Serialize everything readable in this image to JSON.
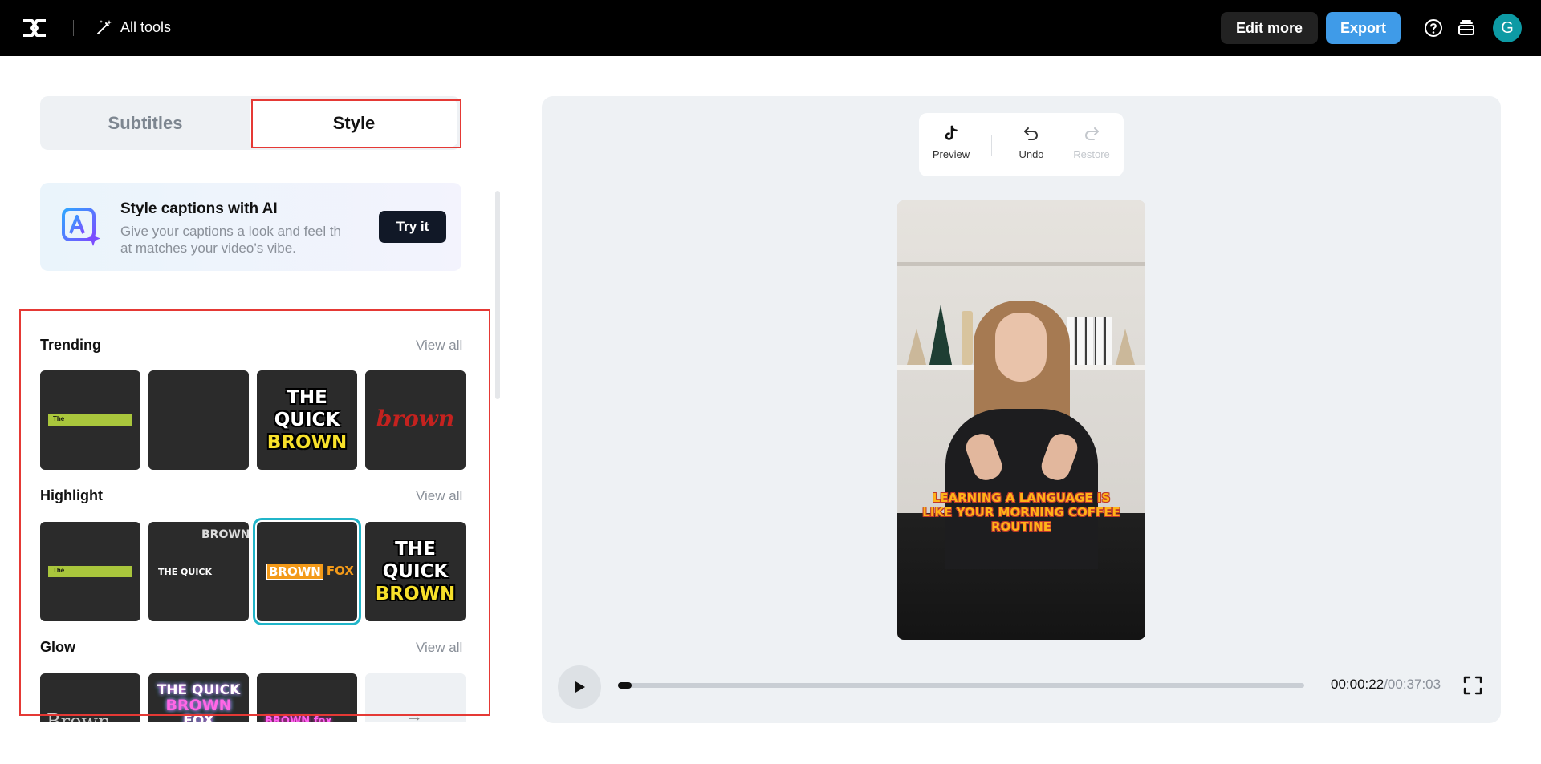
{
  "topbar": {
    "all_tools_label": "All tools",
    "edit_more_label": "Edit more",
    "export_label": "Export",
    "avatar_initial": "G",
    "accent_color": "#3f9be8"
  },
  "left": {
    "tabs": [
      {
        "label": "Subtitles",
        "active": false
      },
      {
        "label": "Style",
        "active": true
      }
    ],
    "ai_card": {
      "title": "Style captions with AI",
      "description": "Give your captions a look and feel that matches your video’s vibe.",
      "description_line1": "Give your captions a look and feel th",
      "description_line2": "at matches your video’s vibe.",
      "button_label": "Try it"
    },
    "sections": [
      {
        "title": "Trending",
        "view_all": "View all",
        "tiles": [
          {
            "text": "The"
          },
          {
            "text": ""
          },
          {
            "lines": [
              "THE",
              "QUICK",
              "BROWN"
            ]
          },
          {
            "text": "brown"
          }
        ]
      },
      {
        "title": "Highlight",
        "view_all": "View all",
        "tiles": [
          {
            "text": "The"
          },
          {
            "top": "BROWN",
            "bottom": "THE QUICK"
          },
          {
            "a": "BROWN",
            "b": "FOX",
            "selected": true
          },
          {
            "lines": [
              "THE",
              "QUICK",
              "BROWN"
            ]
          }
        ]
      },
      {
        "title": "Glow",
        "view_all": "View all",
        "tiles": [
          {
            "text": "Brown"
          },
          {
            "lines": [
              "THE QUICK",
              "BROWN",
              "FOX"
            ]
          },
          {
            "a": "BROWN",
            "b": "fox"
          },
          {
            "icon": "arrow-right-icon"
          }
        ]
      }
    ]
  },
  "editor": {
    "toolbar": {
      "preview_label": "Preview",
      "undo_label": "Undo",
      "restore_label": "Restore"
    },
    "caption_lines": [
      "LEARNING A LANGUAGE IS",
      "LIKE YOUR MORNING COFFEE",
      "ROUTINE"
    ],
    "player": {
      "current_time": "00:00:22",
      "total_time": "/00:37:03",
      "progress_fraction": 0.02
    }
  }
}
